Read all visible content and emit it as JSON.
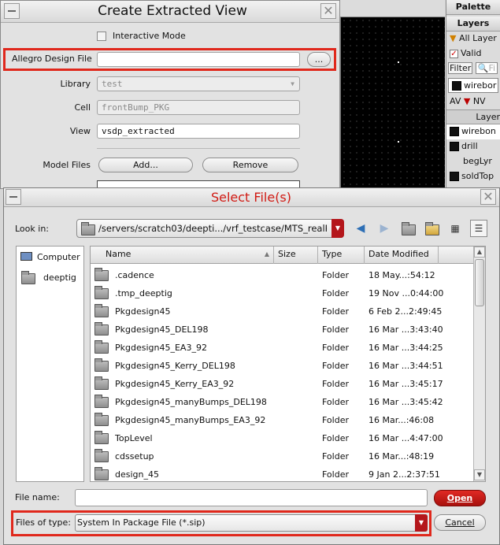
{
  "create_extracted_view": {
    "title": "Create Extracted View",
    "interactive_mode_label": "Interactive Mode",
    "allegro_label": "Allegro Design File",
    "allegro_value": "",
    "browse_label": "...",
    "library_label": "Library",
    "library_value": "test",
    "cell_label": "Cell",
    "cell_value": "frontBump_PKG",
    "view_label": "View",
    "view_value": "vsdp_extracted",
    "model_files_label": "Model Files",
    "add_label": "Add...",
    "remove_label": "Remove"
  },
  "palette": {
    "title": "Palette",
    "layers_title": "Layers",
    "all_layers": "All Layer",
    "valid_label": "Valid",
    "filter_label": "Filter",
    "filter_placeholder": "Fi",
    "current_layer": "wirebor",
    "av_label": "AV",
    "nv_label": "NV",
    "layer_col": "Layer",
    "layers": [
      {
        "name": "wirebon",
        "color": "#ffff00"
      },
      {
        "name": "drill",
        "color": "#ffe000"
      },
      {
        "name": "begLyr",
        "color": ""
      },
      {
        "name": "soldTop",
        "color": "#ffee00"
      }
    ]
  },
  "select_files": {
    "title": "Select File(s)",
    "look_in_label": "Look in:",
    "look_in_value": "/servers/scratch03/deepti.../vrf_testcase/MTS_realPad",
    "places": [
      {
        "label": "Computer",
        "icon": "computer-icon"
      },
      {
        "label": "deeptig",
        "icon": "folder-icon"
      }
    ],
    "columns": [
      "Name",
      "Size",
      "Type",
      "Date Modified"
    ],
    "files": [
      {
        "name": ".cadence",
        "size": "",
        "type": "Folder",
        "date": "18 May...:54:12"
      },
      {
        "name": ".tmp_deeptig",
        "size": "",
        "type": "Folder",
        "date": "19 Nov ...0:44:00"
      },
      {
        "name": "Pkgdesign45",
        "size": "",
        "type": "Folder",
        "date": "6 Feb 2...2:49:45"
      },
      {
        "name": "Pkgdesign45_DEL198",
        "size": "",
        "type": "Folder",
        "date": "16 Mar ...3:43:40"
      },
      {
        "name": "Pkgdesign45_EA3_92",
        "size": "",
        "type": "Folder",
        "date": "16 Mar ...3:44:25"
      },
      {
        "name": "Pkgdesign45_Kerry_DEL198",
        "size": "",
        "type": "Folder",
        "date": "16 Mar ...3:44:51"
      },
      {
        "name": "Pkgdesign45_Kerry_EA3_92",
        "size": "",
        "type": "Folder",
        "date": "16 Mar ...3:45:17"
      },
      {
        "name": "Pkgdesign45_manyBumps_DEL198",
        "size": "",
        "type": "Folder",
        "date": "16 Mar ...3:45:42"
      },
      {
        "name": "Pkgdesign45_manyBumps_EA3_92",
        "size": "",
        "type": "Folder",
        "date": "16 Mar...:46:08"
      },
      {
        "name": "TopLevel",
        "size": "",
        "type": "Folder",
        "date": "16 Mar ...4:47:00"
      },
      {
        "name": "cdssetup",
        "size": "",
        "type": "Folder",
        "date": "16 Mar...:48:19"
      },
      {
        "name": "design_45",
        "size": "",
        "type": "Folder",
        "date": "9 Jan 2...2:37:51"
      }
    ],
    "file_name_label": "File name:",
    "file_name_value": "",
    "files_of_type_label": "Files of type:",
    "files_of_type_value": "System In Package File (*.sip)",
    "open_label": "Open",
    "cancel_label": "Cancel"
  }
}
